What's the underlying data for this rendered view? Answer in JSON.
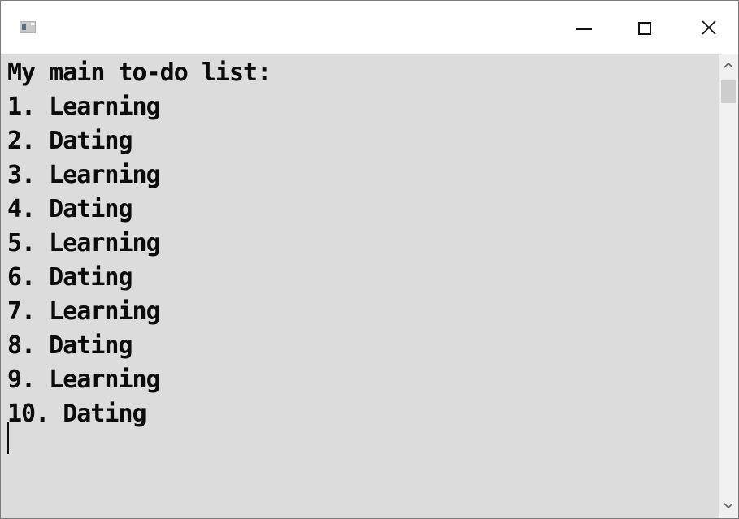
{
  "window": {
    "icon": "console-app-icon",
    "controls": {
      "minimize": "minimize-icon",
      "maximize": "maximize-icon",
      "close": "close-icon"
    }
  },
  "console": {
    "header": "My main to-do list:",
    "items": [
      "1. Learning",
      "2. Dating",
      "3. Learning",
      "4. Dating",
      "5. Learning",
      "6. Dating",
      "7. Learning",
      "8. Dating",
      "9. Learning",
      "10. Dating"
    ]
  },
  "colors": {
    "console_background": "#dcdcdc",
    "console_text": "#0c0c0c",
    "titlebar_background": "#ffffff",
    "scrollbar_track": "#f0f0f0",
    "scrollbar_thumb": "#cdcdcd"
  }
}
